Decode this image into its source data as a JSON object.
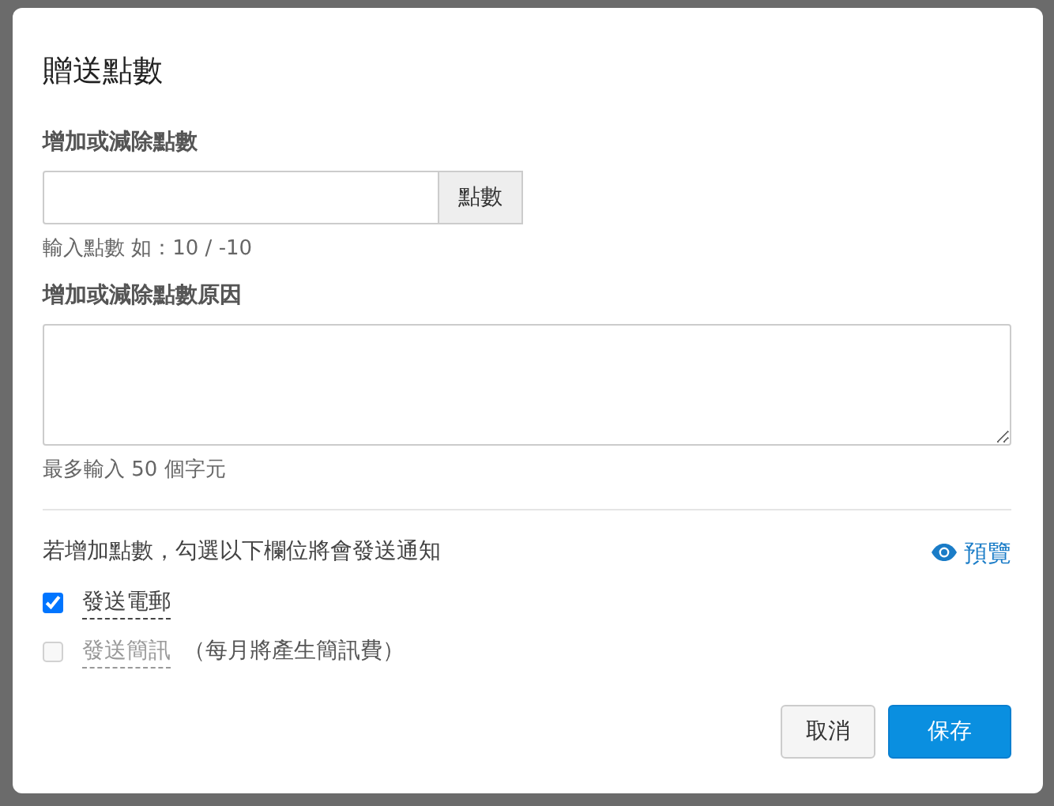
{
  "modal": {
    "title": "贈送點數"
  },
  "points_field": {
    "label": "增加或減除點數",
    "addon": "點數",
    "help": "輸入點數 如：10 / -10"
  },
  "reason_field": {
    "label": "增加或減除點數原因",
    "help": "最多輸入 50 個字元"
  },
  "notify": {
    "text": "若增加點數，勾選以下欄位將會發送通知",
    "preview_link": "預覽"
  },
  "options": [
    {
      "label": "發送電郵",
      "checked": true,
      "disabled": false
    },
    {
      "label": "發送簡訊",
      "note": "（每月將產生簡訊費）",
      "checked": false,
      "disabled": true
    }
  ],
  "buttons": [
    {
      "label": "取消",
      "kind": "secondary"
    },
    {
      "label": "保存",
      "kind": "primary"
    }
  ]
}
